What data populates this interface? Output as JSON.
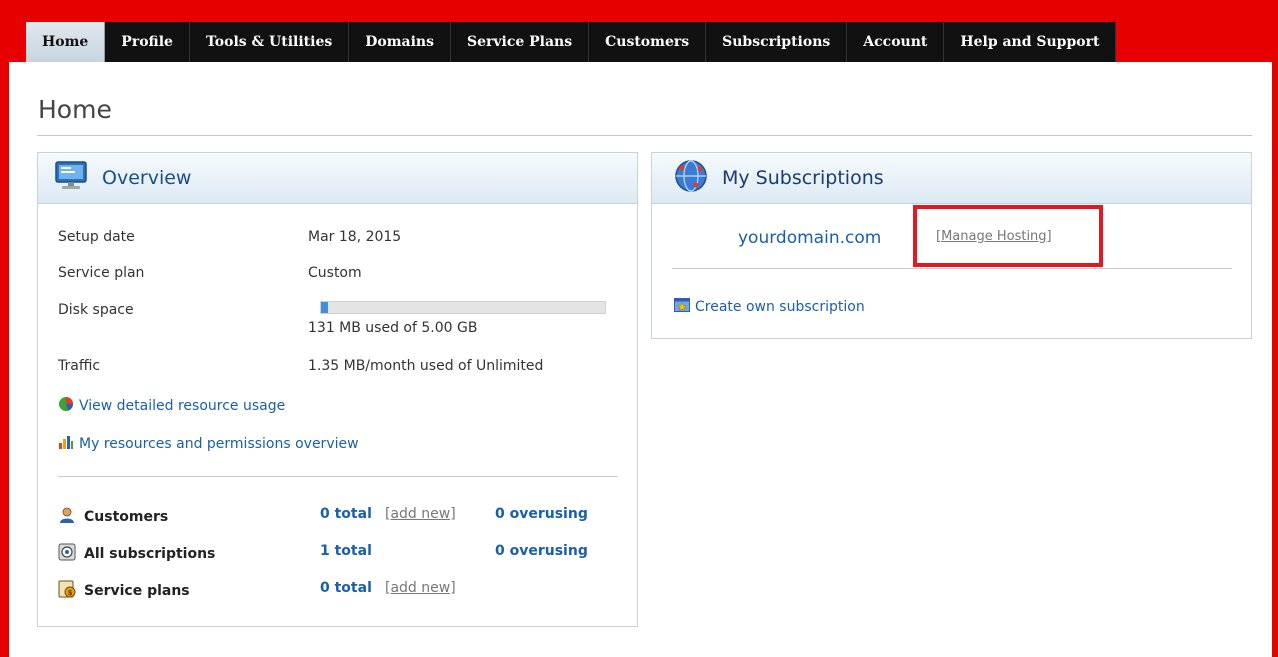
{
  "nav": {
    "tabs": [
      {
        "label": "Home",
        "active": true
      },
      {
        "label": "Profile"
      },
      {
        "label": "Tools & Utilities"
      },
      {
        "label": "Domains"
      },
      {
        "label": "Service Plans"
      },
      {
        "label": "Customers"
      },
      {
        "label": "Subscriptions"
      },
      {
        "label": "Account"
      },
      {
        "label": "Help and Support"
      }
    ]
  },
  "page": {
    "title": "Home"
  },
  "overview": {
    "title": "Overview",
    "setup_date_label": "Setup date",
    "setup_date_value": "Mar 18, 2015",
    "service_plan_label": "Service plan",
    "service_plan_value": "Custom",
    "disk_space_label": "Disk space",
    "disk_space_value": "131 MB used of 5.00 GB",
    "disk_usage_fraction": 0.026,
    "traffic_label": "Traffic",
    "traffic_value": "1.35 MB/month used of Unlimited",
    "view_usage_link": "View detailed resource usage",
    "permissions_link": "My resources and permissions overview",
    "stats": {
      "customers": {
        "label": "Customers",
        "total": "0 total",
        "add": "[add new]",
        "overusing": "0 overusing"
      },
      "subscriptions": {
        "label": "All subscriptions",
        "total": "1 total",
        "overusing": "0 overusing"
      },
      "plans": {
        "label": "Service plans",
        "total": "0 total",
        "add": "[add new]"
      }
    }
  },
  "subscriptions": {
    "title": "My Subscriptions",
    "domain": "yourdomain.com",
    "manage_link": "[Manage Hosting]",
    "create_link": "Create own subscription"
  },
  "colors": {
    "frame": "#e60000",
    "accent": "#1a5fa9",
    "highlight": "#e01a22"
  }
}
